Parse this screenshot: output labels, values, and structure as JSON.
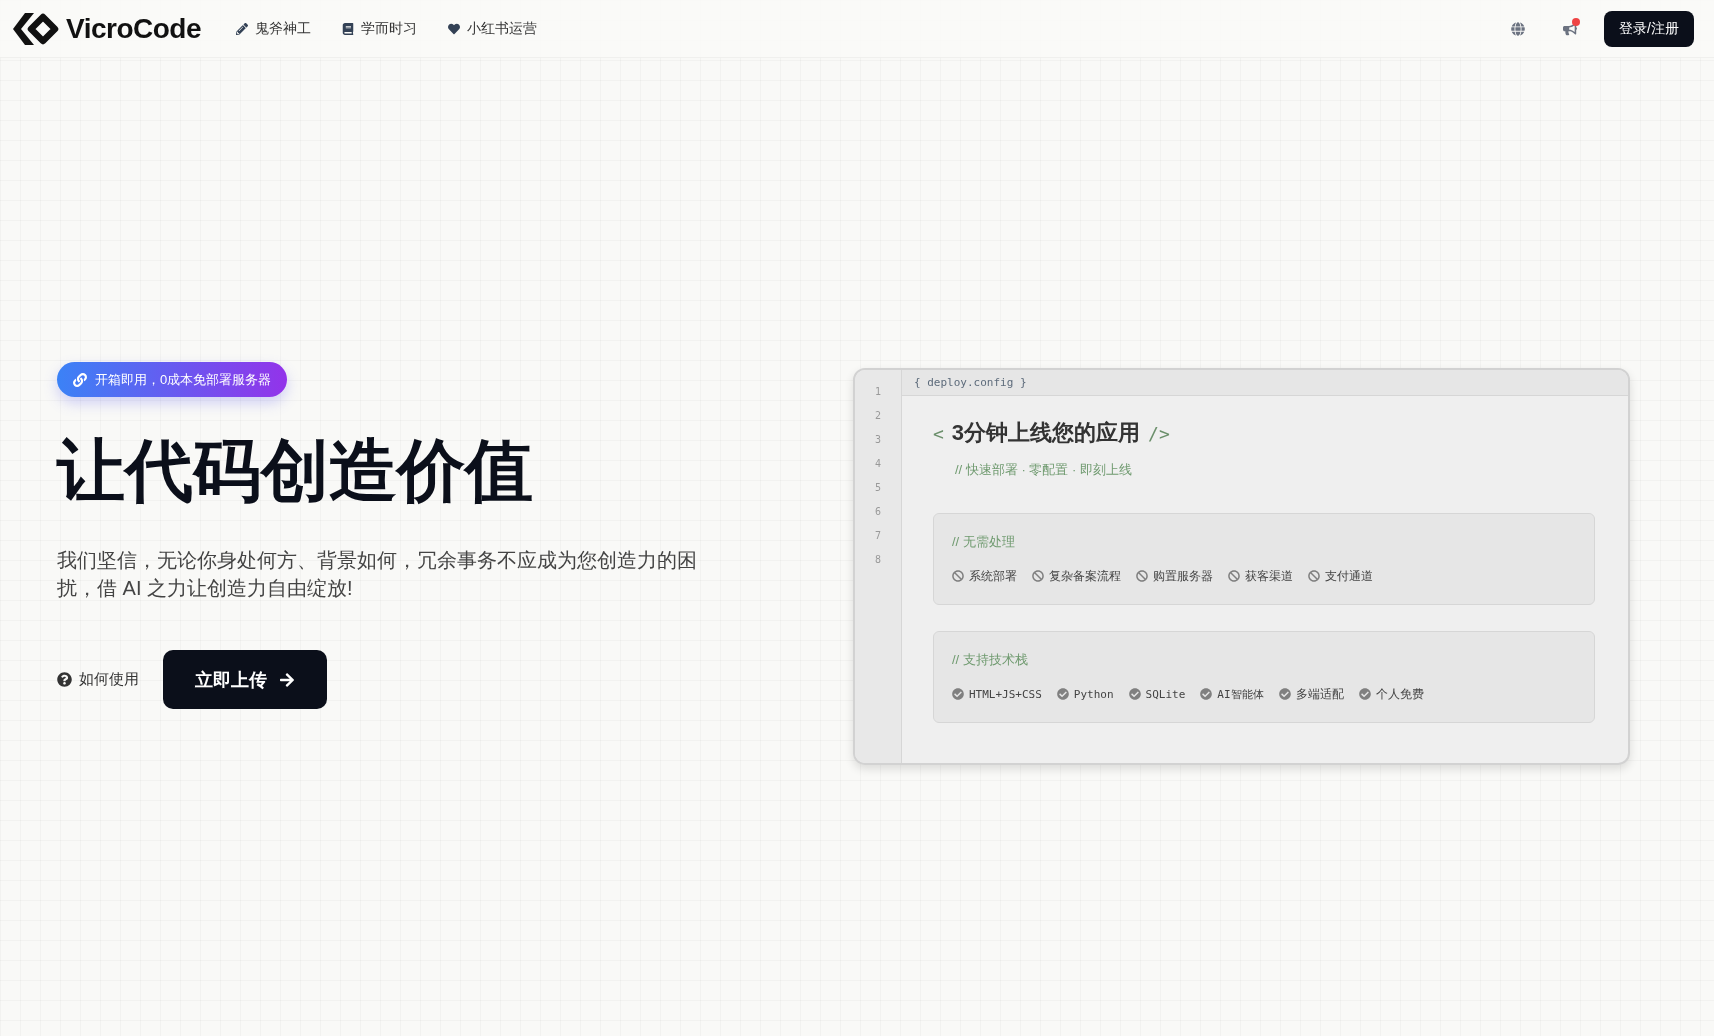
{
  "nav": {
    "brand": "VicroCode",
    "links": [
      {
        "label": "鬼斧神工"
      },
      {
        "label": "学而时习"
      },
      {
        "label": "小红书运营"
      }
    ],
    "announcement": {
      "unread": true
    },
    "login": "登录/注册"
  },
  "hero": {
    "badge": "开箱即用，0成本免部署服务器",
    "title": "让代码创造价值",
    "description": "我们坚信，无论你身处何方、背景如何，冗余事务不应成为您创造力的困扰，借 AI 之力让创造力自由绽放!",
    "help_link": "如何使用",
    "cta": "立即上传"
  },
  "code_panel": {
    "filename": "{ deploy.config }",
    "line_numbers": [
      "1",
      "2",
      "3",
      "4",
      "5",
      "6",
      "7",
      "8"
    ],
    "title_open": "<",
    "title": "3分钟上线您的应用",
    "title_close": "/>",
    "subtitle": "// 快速部署 · 零配置 · 即刻上线",
    "groups": [
      {
        "kind": "excluded",
        "comment": "// 无需处理",
        "items": [
          "系统部署",
          "复杂备案流程",
          "购置服务器",
          "获客渠道",
          "支付通道"
        ]
      },
      {
        "kind": "supported",
        "comment": "// 支持技术栈",
        "items": [
          "HTML+JS+CSS",
          "Python",
          "SQLite",
          "AI智能体",
          "多端适配",
          "个人免费"
        ]
      }
    ]
  }
}
